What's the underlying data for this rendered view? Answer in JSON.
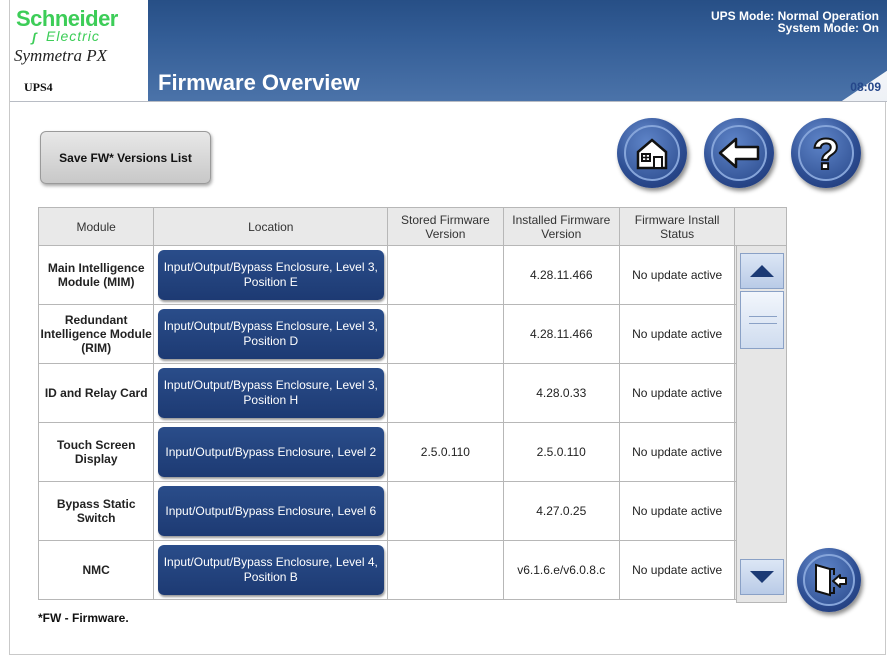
{
  "brand": {
    "name_top": "Schneider",
    "name_sub": "Electric",
    "product": "Symmetra PX",
    "unit": "UPS4"
  },
  "header": {
    "title": "Firmware Overview",
    "ups_mode": "UPS Mode: Normal Operation",
    "system_mode": "System Mode: On",
    "clock": "08:09"
  },
  "toolbar": {
    "save_label": "Save FW* Versions List"
  },
  "nav": {
    "home": "home-icon",
    "back": "back-arrow-icon",
    "help": "help-icon",
    "exit": "exit-door-icon"
  },
  "table": {
    "headers": [
      "Module",
      "Location",
      "Stored Firmware Version",
      "Installed Firmware Version",
      "Firmware Install Status"
    ],
    "rows": [
      {
        "module": "Main Intelligence Module (MIM)",
        "location": "Input/Output/Bypass Enclosure, Level 3, Position E",
        "stored": "",
        "installed": "4.28.11.466",
        "status": "No update active"
      },
      {
        "module": "Redundant Intelligence Module (RIM)",
        "location": "Input/Output/Bypass Enclosure, Level 3, Position D",
        "stored": "",
        "installed": "4.28.11.466",
        "status": "No update active"
      },
      {
        "module": "ID and Relay Card",
        "location": "Input/Output/Bypass Enclosure, Level 3, Position H",
        "stored": "",
        "installed": "4.28.0.33",
        "status": "No update active"
      },
      {
        "module": "Touch Screen Display",
        "location": "Input/Output/Bypass Enclosure, Level 2",
        "stored": "2.5.0.110",
        "installed": "2.5.0.110",
        "status": "No update active"
      },
      {
        "module": "Bypass Static Switch",
        "location": "Input/Output/Bypass Enclosure, Level 6",
        "stored": "",
        "installed": "4.27.0.25",
        "status": "No update active"
      },
      {
        "module": "NMC",
        "location": "Input/Output/Bypass Enclosure, Level 4, Position B",
        "stored": "",
        "installed": "v6.1.6.e/v6.0.8.c",
        "status": "No update active"
      }
    ]
  },
  "footnote": "*FW - Firmware.",
  "colors": {
    "banner": "#345e97",
    "button": "#1d3a73",
    "brand_green": "#3dcd58"
  }
}
